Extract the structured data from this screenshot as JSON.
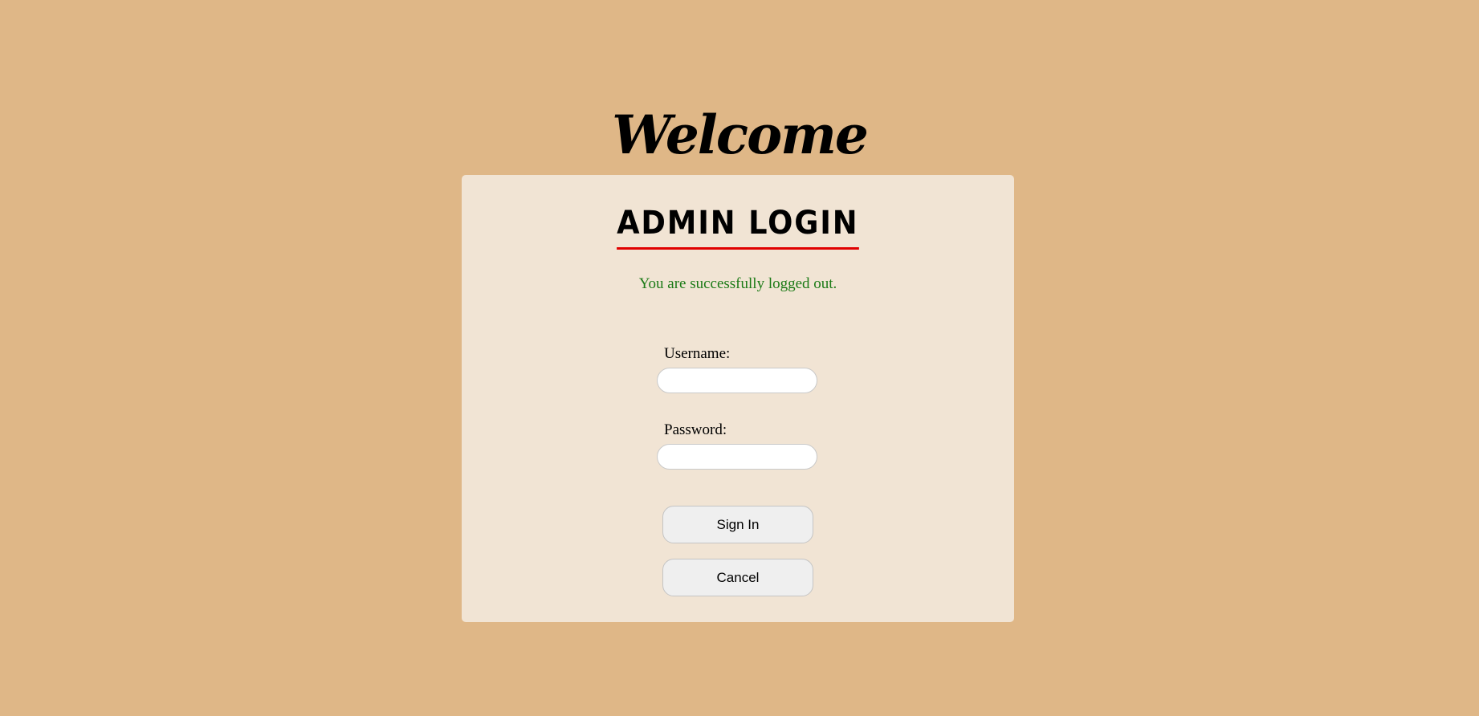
{
  "page": {
    "heading": "Welcome",
    "background_color": "#dfb787"
  },
  "card": {
    "background_color": "#f1e4d4",
    "title": "ADMIN LOGIN",
    "title_underline_color": "#e00000",
    "status_message": "You are successfully logged out.",
    "status_color": "#1c7a16"
  },
  "form": {
    "username_label": "Username:",
    "username_value": "",
    "password_label": "Password:",
    "password_value": "",
    "sign_in_label": "Sign In",
    "cancel_label": "Cancel"
  }
}
